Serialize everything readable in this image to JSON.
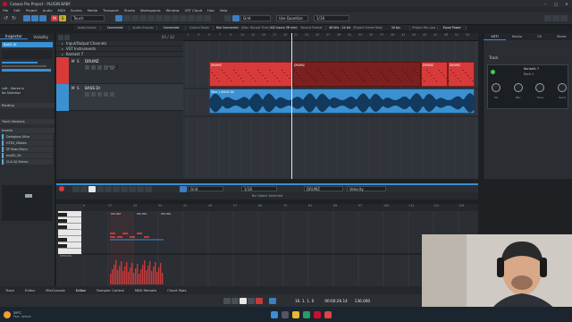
{
  "window": {
    "title": "Cubase Pro Project - PLUGIN BABY"
  },
  "menu": [
    "File",
    "Edit",
    "Project",
    "Audio",
    "MIDI",
    "Scores",
    "Media",
    "Transport",
    "Studio",
    "Workspaces",
    "Window",
    "VST Cloud",
    "Hub",
    "Help"
  ],
  "toolbar": {
    "mode": "Touch",
    "grid": "Grid",
    "quantize_mode": "Use Quantize",
    "quantize_value": "1/16"
  },
  "status_bar": [
    "Audio Inputs",
    "Connected",
    "Audio Outputs",
    "Connected",
    "Control Room",
    "Not Connected",
    "Max. Record Time",
    "442 hours 38 mins",
    "Record Format",
    "48 kHz - 24 bit",
    "Project Frame Rate",
    "30 fps",
    "Project Pan Law",
    "Equal Power"
  ],
  "inspector": {
    "tabs": [
      "Inspector",
      "Visibility"
    ],
    "track_name": "BASS DI",
    "sections": {
      "routing": "Routing",
      "inserts": "Inserts",
      "versions": "Track Versions"
    },
    "input": "Left - Stereo In",
    "output": "No Selection",
    "inserts": [
      "Darkglass Ultra",
      "GTR3_2Notes",
      "SP Bass Mono",
      "ms/82_54",
      "CLA-3A Stereo"
    ]
  },
  "track_list": {
    "counter": "05 / 32",
    "folders": [
      "Input/Output Channels",
      "VST Instruments",
      "Kontakt 7"
    ],
    "tracks": [
      {
        "name": "DRUMZ",
        "color": "#d83a3a",
        "controls": [
          "M",
          "S"
        ],
        "extra": "Plan 1"
      },
      {
        "name": "BASS DI",
        "color": "#3a90d0",
        "controls": [
          "M",
          "S"
        ],
        "extra": ""
      }
    ]
  },
  "arrange": {
    "ruler": [
      "1",
      "3",
      "5",
      "7",
      "9",
      "11",
      "13",
      "15",
      "17",
      "19",
      "21",
      "23",
      "25",
      "27",
      "29",
      "31",
      "33",
      "35",
      "37",
      "39",
      "41",
      "43",
      "45",
      "47",
      "49",
      "51",
      "53"
    ],
    "drum_clips": [
      "DRUMZ",
      "DRUMZ",
      "DRUMZ",
      "DRUMZ"
    ],
    "bass_clip": "Take 1 (BASS DI)"
  },
  "right_panel": {
    "tabs": [
      "VSTi",
      "Media",
      "CR",
      "Meter"
    ],
    "section": "Track",
    "instrument": "Kontakt 7",
    "rack": "Rack 1",
    "knob_labels": [
      "Vol",
      "Pan",
      "Tune",
      "Send"
    ]
  },
  "editor": {
    "grid": "Grid",
    "quant": "1/16",
    "part": "DRUMZ",
    "velocity": "Velocity",
    "no_object": "No Object Selected",
    "ruler": [
      "9",
      "17",
      "25",
      "33",
      "41",
      "49",
      "57",
      "65",
      "73",
      "81",
      "89",
      "97",
      "105",
      "113",
      "121",
      "129"
    ],
    "parts": [
      "DRUMZ",
      "DRUMZ",
      "DRUMZ"
    ],
    "controller_lane": "Velocity"
  },
  "bottom_tabs": [
    "Track",
    "Editor",
    "MixConsole",
    "Editor",
    "Sampler Control",
    "MIDI Remote",
    "Chord Pads"
  ],
  "transport": {
    "position": "16. 1. 1. 0",
    "time": "00:00:26.14",
    "tempo": "136.000"
  },
  "taskbar": {
    "weather_temp": "29°C",
    "weather_desc": "Parc. nebulo",
    "time": "19:55",
    "date": "22/07/2023"
  },
  "colors": {
    "drum": "#d83a3a",
    "bass": "#3a90d0",
    "accent": "#3a8fd4",
    "cursor": "#ffffff"
  }
}
